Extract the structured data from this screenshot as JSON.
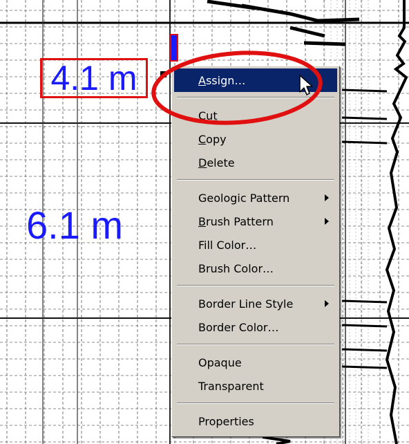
{
  "depth_labels": {
    "selected": "4.1 m",
    "plain": "6.1 m"
  },
  "context_menu": {
    "highlighted_index": 0,
    "groups": [
      [
        {
          "label": "Assign…",
          "mnemonic": "A",
          "submenu": false
        }
      ],
      [
        {
          "label": "Cut",
          "mnemonic": "t",
          "submenu": false
        },
        {
          "label": "Copy",
          "mnemonic": "C",
          "submenu": false
        },
        {
          "label": "Delete",
          "mnemonic": "D",
          "submenu": false
        }
      ],
      [
        {
          "label": "Geologic Pattern",
          "mnemonic": "",
          "submenu": true
        },
        {
          "label": "Brush Pattern",
          "mnemonic": "B",
          "submenu": true
        },
        {
          "label": "Fill Color…",
          "mnemonic": "",
          "submenu": false
        },
        {
          "label": "Brush Color…",
          "mnemonic": "",
          "submenu": false
        }
      ],
      [
        {
          "label": "Border Line Style",
          "mnemonic": "",
          "submenu": true
        },
        {
          "label": "Border Color…",
          "mnemonic": "",
          "submenu": false
        }
      ],
      [
        {
          "label": "Opaque",
          "mnemonic": "",
          "submenu": false
        },
        {
          "label": "Transparent",
          "mnemonic": "",
          "submenu": false
        }
      ],
      [
        {
          "label": "Properties",
          "mnemonic": "",
          "submenu": false
        }
      ]
    ]
  },
  "colors": {
    "label_text": "#1a1aff",
    "selection_box": "#e01010",
    "annotation": "#e01010",
    "menu_bg": "#d4d0c8",
    "menu_highlight": "#0a246a"
  },
  "icons": {
    "cursor": "arrow-cursor-icon",
    "submenu": "submenu-arrow-icon"
  }
}
